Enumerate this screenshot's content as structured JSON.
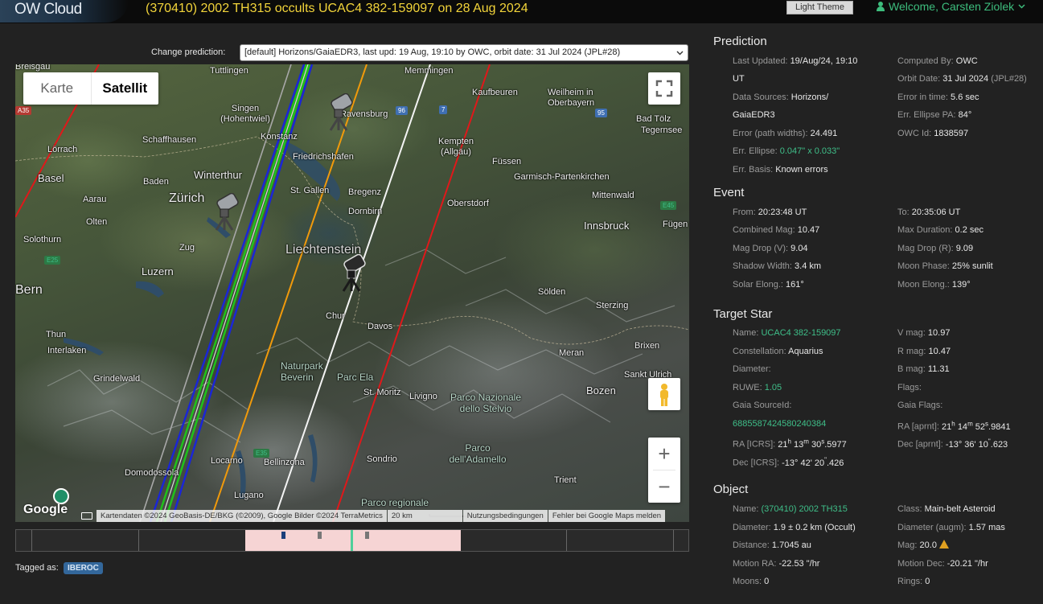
{
  "header": {
    "logo": "OW Cloud",
    "title": "(370410) 2002 TH315 occults UCAC4 382-159097 on 28 Aug 2024",
    "theme_button": "Light Theme",
    "welcome": "Welcome, Carsten Ziolek"
  },
  "prediction_select": {
    "label": "Change prediction:",
    "value": "[default] Horizons/GaiaEDR3, last upd: 19 Aug, 19:10 by OWC, orbit date: 31 Jul 2024 (JPL#28)"
  },
  "map": {
    "type_map": "Karte",
    "type_satellite": "Satellit",
    "places": [
      "Breisgau",
      "Tuttlingen",
      "Memmingen",
      "Singen (Hohentwiel)",
      "Ravensburg",
      "Kaufbeuren",
      "Weilheim in Oberbayern",
      "Bad Tölz",
      "Tegernsee",
      "Lörrach",
      "Schaffhausen",
      "Konstanz",
      "Friedrichshafen",
      "Kempten (Allgäu)",
      "Füssen",
      "Garmisch-Partenkirchen",
      "Basel",
      "Winterthur",
      "Baden",
      "Zürich",
      "St. Gallen",
      "Bregenz",
      "Dornbirn",
      "Oberstdorf",
      "Mittenwald",
      "Aarau",
      "Olten",
      "Solothurn",
      "Innsbruck",
      "Fügen",
      "Zug",
      "Liechtenstein",
      "Luzern",
      "Bern",
      "Sölden",
      "Chur",
      "Davos",
      "Sterzing",
      "Thun",
      "Interlaken",
      "Meran",
      "Brixen",
      "Naturpark Beverin",
      "Parc Ela",
      "Grindelwald",
      "St. Moritz",
      "Livigno",
      "Parco Nazionale dello Stelvio",
      "Sankt Ulrich",
      "Bozen",
      "Domodossola",
      "Locarno",
      "Bellinzona",
      "Sondrio",
      "Parco dell'Adamello",
      "Trient",
      "Lugano",
      "Parco regionale"
    ],
    "shields": [
      "A35",
      "96",
      "7",
      "95",
      "E45",
      "E25",
      "E35"
    ],
    "google": "Google",
    "attribution": [
      "Kartendaten ©2024 GeoBasis-DE/BKG (©2009), Google Bilder ©2024 TerraMetrics",
      "20 km",
      "Nutzungsbedingungen",
      "Fehler bei Google Maps melden"
    ]
  },
  "tagged": {
    "label": "Tagged as:",
    "tag": "IBEROC"
  },
  "prediction": {
    "title": "Prediction",
    "last_updated_label": "Last Updated:",
    "last_updated": "19/Aug/24, 19:10",
    "last_updated_2": "UT",
    "computed_by_label": "Computed By:",
    "computed_by": "OWC",
    "data_sources_label": "Data Sources:",
    "data_sources": "Horizons/",
    "data_sources_2": "GaiaEDR3",
    "orbit_date_label": "Orbit Date:",
    "orbit_date": "31 Jul 2024",
    "orbit_ref": "(JPL#28)",
    "error_time_label": "Error in time:",
    "error_time": "5.6 sec",
    "error_pw_label": "Error (path widths):",
    "error_pw": "24.491",
    "err_ellipse_pa_label": "Err. Ellipse PA:",
    "err_ellipse_pa": "84°",
    "err_ellipse_label": "Err. Ellipse:",
    "err_ellipse": "0.047\" x 0.033\"",
    "owc_id_label": "OWC Id:",
    "owc_id": "1838597",
    "err_basis_label": "Err. Basis:",
    "err_basis": "Known errors"
  },
  "event": {
    "title": "Event",
    "from_label": "From:",
    "from": "20:23:48 UT",
    "to_label": "To:",
    "to": "20:35:06 UT",
    "comb_mag_label": "Combined Mag:",
    "comb_mag": "10.47",
    "max_dur_label": "Max Duration:",
    "max_dur": "0.2 sec",
    "drop_v_label": "Mag Drop (V):",
    "drop_v": "9.04",
    "drop_r_label": "Mag Drop (R):",
    "drop_r": "9.09",
    "shadow_label": "Shadow Width:",
    "shadow": "3.4 km",
    "moon_phase_label": "Moon Phase:",
    "moon_phase": "25% sunlit",
    "solar_elong_label": "Solar Elong.:",
    "solar_elong": "161°",
    "moon_elong_label": "Moon Elong.:",
    "moon_elong": "139°"
  },
  "star": {
    "title": "Target Star",
    "name_label": "Name:",
    "name": "UCAC4 382-159097",
    "vmag_label": "V mag:",
    "vmag": "10.97",
    "const_label": "Constellation:",
    "const": "Aquarius",
    "rmag_label": "R mag:",
    "rmag": "10.47",
    "diam_label": "Diameter:",
    "bmag_label": "B mag:",
    "bmag": "11.31",
    "ruwe_label": "RUWE:",
    "ruwe": "1.05",
    "flags_label": "Flags:",
    "source_label": "Gaia SourceId:",
    "gaia_flags_label": "Gaia Flags:",
    "source": "6885587424580240384",
    "ra_aprnt_label": "RA [aprnt]:",
    "ra_aprnt_h": "21",
    "ra_aprnt_m": "14",
    "ra_aprnt_s": "52",
    "ra_aprnt_f": ".9841",
    "ra_icrs_label": "RA [ICRS]:",
    "ra_icrs_h": "21",
    "ra_icrs_m": "13",
    "ra_icrs_s": "30",
    "ra_icrs_f": ".5977",
    "dec_aprnt_label": "Dec [aprnt]:",
    "dec_aprnt_d": "-13° 36",
    "dec_aprnt_s": "10",
    "dec_aprnt_f": ".623",
    "dec_icrs_label": "Dec [ICRS]:",
    "dec_icrs_d": "-13° 42",
    "dec_icrs_s": "20",
    "dec_icrs_f": ".426"
  },
  "object": {
    "title": "Object",
    "name_label": "Name:",
    "name": "(370410) 2002 TH315",
    "class_label": "Class:",
    "class": "Main-belt Asteroid",
    "diam_label": "Diameter:",
    "diam": "1.9 ± 0.2 km",
    "diam_src": "(Occult)",
    "diam_augm_label": "Diameter (augm):",
    "diam_augm": "1.57 mas",
    "dist_label": "Distance:",
    "dist": "1.7045 au",
    "mag_label": "Mag:",
    "mag": "20.0",
    "mra_label": "Motion RA:",
    "mra": "-22.53 \"/hr",
    "mdec_label": "Motion Dec:",
    "mdec": "-20.21 \"/hr",
    "moons_label": "Moons:",
    "moons": "0",
    "rings_label": "Rings:",
    "rings": "0"
  }
}
